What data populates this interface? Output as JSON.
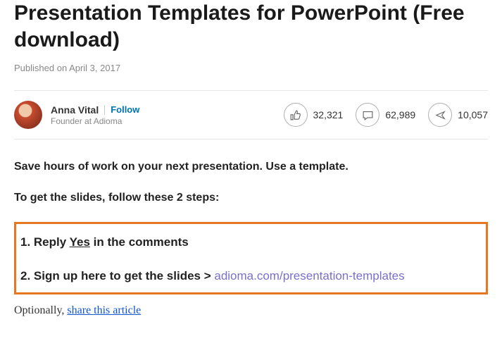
{
  "title": "Presentation Templates for PowerPoint (Free download)",
  "published": "Published on April 3, 2017",
  "author": {
    "name": "Anna Vital",
    "follow": "Follow",
    "subtitle": "Founder at Adioma"
  },
  "stats": {
    "likes": "32,321",
    "comments": "62,989",
    "shares": "10,057"
  },
  "intro1": "Save hours of work on your next presentation. Use a template.",
  "intro2": "To get the slides, follow these 2 steps:",
  "step1_prefix": "1. Reply ",
  "step1_yes": "Yes",
  "step1_suffix": " in the comments",
  "step2_prefix": "2. Sign up here to get the slides > ",
  "step2_link": "adioma.com/presentation-templates",
  "optional_prefix": "Optionally, ",
  "optional_link": "share this article"
}
